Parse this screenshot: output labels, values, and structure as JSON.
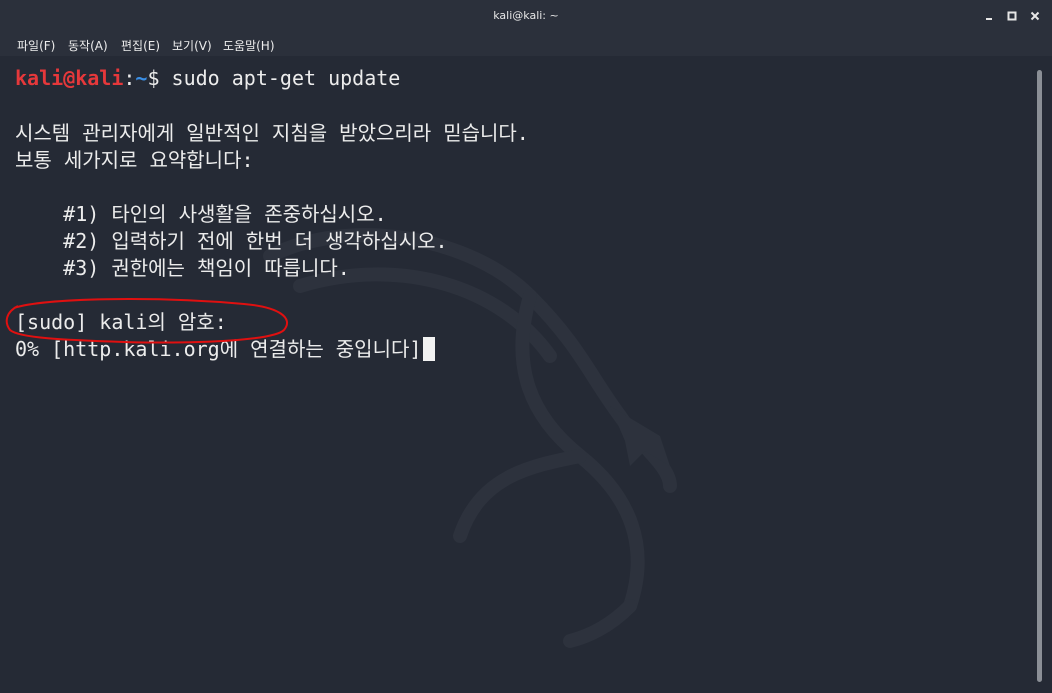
{
  "window": {
    "title": "kali@kali: ~"
  },
  "menu": {
    "items": [
      "파일(F)",
      "동작(A)",
      "편집(E)",
      "보기(V)",
      "도움말(H)"
    ]
  },
  "terminal": {
    "prompt_user": "kali@kali",
    "prompt_colon": ":",
    "prompt_path": "~",
    "prompt_dollar": "$",
    "command": " sudo apt-get update",
    "lecture_1": "시스템 관리자에게 일반적인 지침을 받았으리라 믿습니다.",
    "lecture_2": "보통 세가지로 요약합니다:",
    "lecture_3": "    #1) 타인의 사생활을 존중하십시오.",
    "lecture_4": "    #2) 입력하기 전에 한번 더 생각하십시오.",
    "lecture_5": "    #3) 권한에는 책임이 따릅니다.",
    "sudo_prompt": "[sudo] kali의 암호:",
    "progress": "0% [http.kali.org에 연결하는 중입니다]"
  },
  "colors": {
    "background": "#252a35",
    "titlebar": "#2b303b",
    "prompt_user": "#e5383b",
    "prompt_path": "#3a8fe6",
    "text": "#ececec",
    "annotation": "#e01010"
  },
  "icons": {
    "minimize": "minimize-icon",
    "maximize": "maximize-icon",
    "close": "close-icon",
    "watermark": "kali-dragon-logo"
  }
}
